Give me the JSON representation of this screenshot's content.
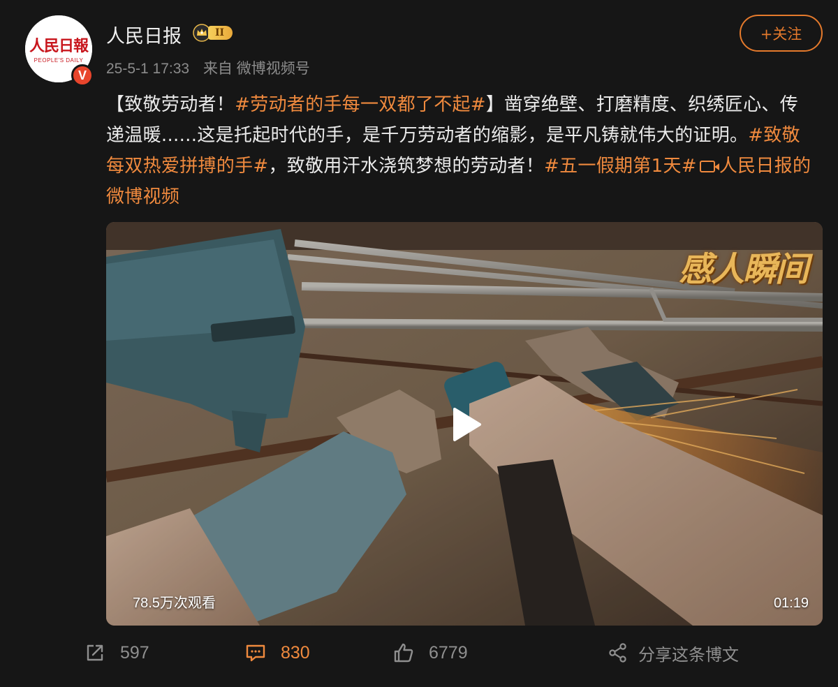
{
  "author": {
    "name": "人民日报",
    "avatar_logo": "人民日報",
    "avatar_sub": "PEOPLE'S DAILY",
    "vip_level": "II",
    "verified_mark": "V"
  },
  "post": {
    "timestamp": "25-5-1 17:33",
    "source": "来自 微博视频号",
    "text_intro": "【致敬劳动者！",
    "tag1": "#劳动者的手每一双都了不起#",
    "text_mid1": "】凿穿绝壁、打磨精度、织绣匠心、传递温暖......这是托起时代的手，是千万劳动者的缩影，是平凡铸就伟大的证明。",
    "tag2": "#致敬每双热爱拼搏的手#",
    "text_mid2": "，致敬用汗水浇筑梦想的劳动者！",
    "tag3": "#五一假期第1天#",
    "video_link": "人民日报的微博视频"
  },
  "follow_button": {
    "label": "+关注"
  },
  "video": {
    "overlay_title": "感人瞬间",
    "views": "78.5万次观看",
    "duration": "01:19"
  },
  "actions": {
    "repost_count": "597",
    "comment_count": "830",
    "like_count": "6779",
    "share_label": "分享这条博文"
  },
  "colors": {
    "accent": "#f08a3e",
    "background": "#161616",
    "muted": "#8c8c8c"
  },
  "icons": [
    "repost-icon",
    "comment-icon",
    "like-icon",
    "share-icon",
    "play-icon",
    "video-link-icon",
    "vip-crown-icon"
  ]
}
